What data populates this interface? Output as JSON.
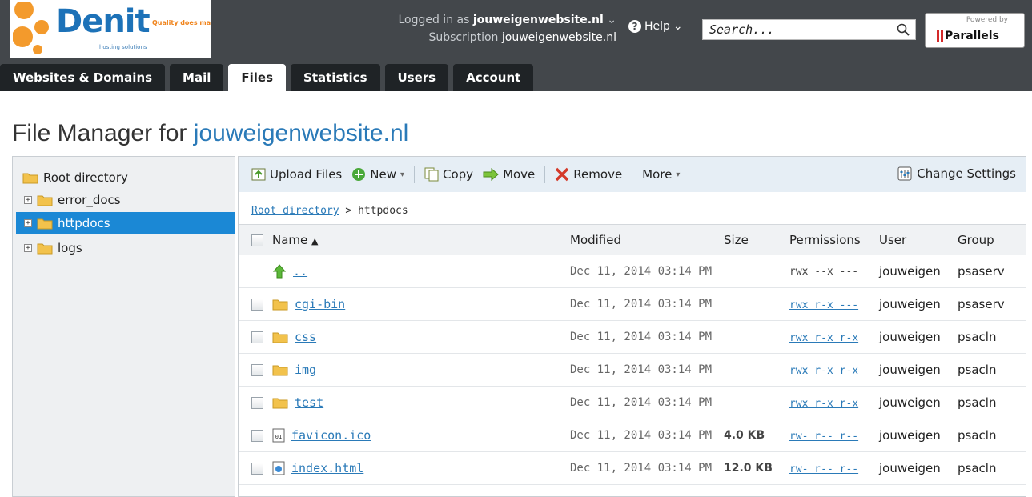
{
  "brand": {
    "name": "Denit",
    "tagline": "Quality does matter",
    "subtitle": "hosting solutions",
    "powered_by": "Powered by",
    "parallels": "Parallels"
  },
  "account": {
    "logged_in_label": "Logged in as",
    "logged_in_value": "jouweigenwebsite.nl",
    "subscription_label": "Subscription",
    "subscription_value": "jouweigenwebsite.nl",
    "help_label": "Help"
  },
  "search": {
    "placeholder": "Search..."
  },
  "tabs": [
    {
      "label": "Websites & Domains",
      "active": false
    },
    {
      "label": "Mail",
      "active": false
    },
    {
      "label": "Files",
      "active": true
    },
    {
      "label": "Statistics",
      "active": false
    },
    {
      "label": "Users",
      "active": false
    },
    {
      "label": "Account",
      "active": false
    }
  ],
  "page": {
    "title_prefix": "File Manager for",
    "title_domain": "jouweigenwebsite.nl"
  },
  "tree": {
    "root": "Root directory",
    "items": [
      {
        "label": "error_docs",
        "selected": false
      },
      {
        "label": "httpdocs",
        "selected": true
      },
      {
        "label": "logs",
        "selected": false
      }
    ]
  },
  "toolbar": {
    "upload": "Upload Files",
    "new": "New",
    "copy": "Copy",
    "move": "Move",
    "remove": "Remove",
    "more": "More",
    "change_settings": "Change Settings"
  },
  "breadcrumb": {
    "root": "Root directory",
    "separator": ">",
    "current": "httpdocs"
  },
  "table": {
    "headers": {
      "name": "Name",
      "modified": "Modified",
      "size": "Size",
      "permissions": "Permissions",
      "user": "User",
      "group": "Group"
    },
    "rows": [
      {
        "type": "up",
        "name": "..",
        "modified": "Dec 11, 2014 03:14 PM",
        "size": "",
        "permissions": "rwx --x ---",
        "perm_link": false,
        "user": "jouweigen",
        "group": "psaserv"
      },
      {
        "type": "folder",
        "name": "cgi-bin",
        "modified": "Dec 11, 2014 03:14 PM",
        "size": "",
        "permissions": "rwx r-x ---",
        "perm_link": true,
        "user": "jouweigen",
        "group": "psaserv"
      },
      {
        "type": "folder",
        "name": "css",
        "modified": "Dec 11, 2014 03:14 PM",
        "size": "",
        "permissions": "rwx r-x r-x",
        "perm_link": true,
        "user": "jouweigen",
        "group": "psacln"
      },
      {
        "type": "folder",
        "name": "img",
        "modified": "Dec 11, 2014 03:14 PM",
        "size": "",
        "permissions": "rwx r-x r-x",
        "perm_link": true,
        "user": "jouweigen",
        "group": "psacln"
      },
      {
        "type": "folder",
        "name": "test",
        "modified": "Dec 11, 2014 03:14 PM",
        "size": "",
        "permissions": "rwx r-x r-x",
        "perm_link": true,
        "user": "jouweigen",
        "group": "psacln"
      },
      {
        "type": "ico",
        "name": "favicon.ico",
        "modified": "Dec 11, 2014 03:14 PM",
        "size": "4.0 KB",
        "permissions": "rw- r-- r--",
        "perm_link": true,
        "user": "jouweigen",
        "group": "psacln"
      },
      {
        "type": "html",
        "name": "index.html",
        "modified": "Dec 11, 2014 03:14 PM",
        "size": "12.0 KB",
        "permissions": "rw- r-- r--",
        "perm_link": true,
        "user": "jouweigen",
        "group": "psacln"
      }
    ]
  },
  "colors": {
    "header_bg": "#43474b",
    "tab_bg": "#1f2326",
    "accent": "#2a7ab8",
    "selected": "#1b88d5",
    "folder": "#f2c24c"
  },
  "icons": {
    "search": "magnifier-icon",
    "help": "question-circle-icon",
    "folder": "folder-icon",
    "up": "green-up-arrow-icon",
    "upload": "upload-icon",
    "new": "green-plus-icon",
    "copy": "copy-icon",
    "move": "green-arrow-right-icon",
    "remove": "red-x-icon",
    "settings": "settings-sliders-icon"
  }
}
